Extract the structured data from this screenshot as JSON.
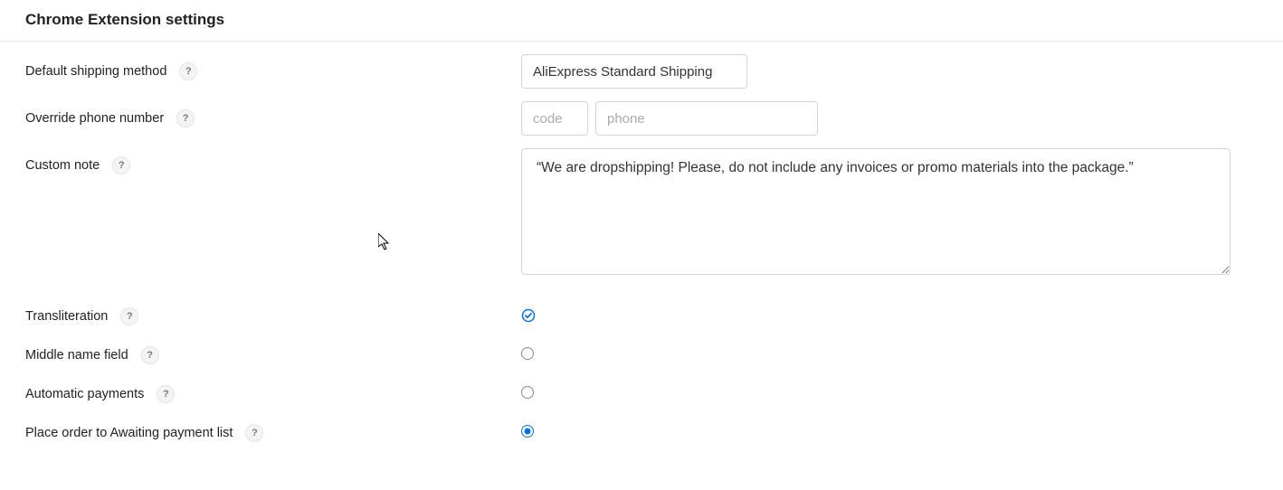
{
  "title": "Chrome Extension settings",
  "fields": {
    "shipping": {
      "label": "Default shipping method",
      "value": "AliExpress Standard Shipping"
    },
    "phone": {
      "label": "Override phone number",
      "code_placeholder": "code",
      "phone_placeholder": "phone"
    },
    "note": {
      "label": "Custom note",
      "value": "“We are dropshipping! Please, do not include any invoices or promo materials into the package.”"
    },
    "translit": {
      "label": "Transliteration",
      "checked": true
    },
    "middle": {
      "label": "Middle name field",
      "checked": false
    },
    "autopay": {
      "label": "Automatic payments",
      "checked": false
    },
    "awaiting": {
      "label": "Place order to Awaiting payment list",
      "checked": true
    }
  },
  "help_glyph": "?"
}
